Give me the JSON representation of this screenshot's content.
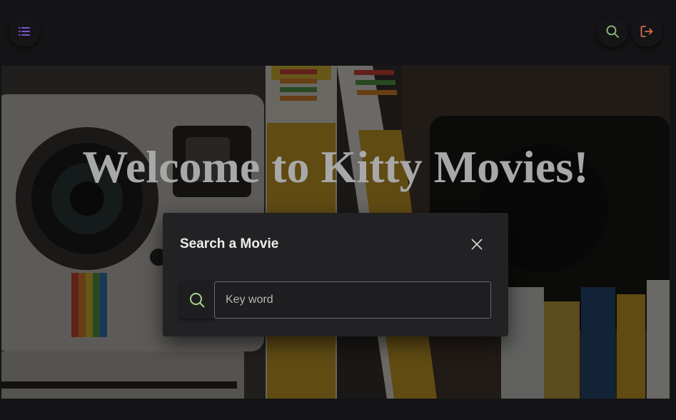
{
  "header": {
    "menu_icon": "list-menu-icon",
    "search_icon": "search-icon",
    "logout_icon": "logout-icon"
  },
  "hero": {
    "title": "Welcome to Kitty Movies!"
  },
  "search_modal": {
    "title": "Search a Movie",
    "close_icon": "close-icon",
    "input_icon": "search-icon",
    "input_value": "",
    "placeholder": "Key word"
  },
  "colors": {
    "background": "#141416",
    "modal_bg": "#222224",
    "menu_icon": "#8c5cf0",
    "search_icon": "#8cc07a",
    "logout_icon": "#d26e4b"
  }
}
